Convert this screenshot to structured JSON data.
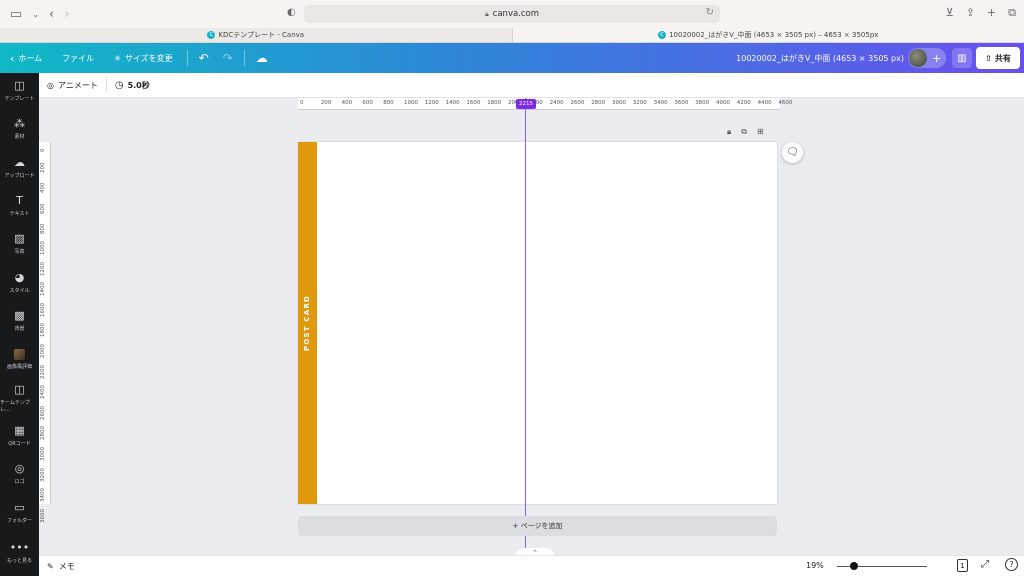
{
  "browser": {
    "url": "canva.com",
    "tabs": [
      {
        "label": "KDCテンプレート - Canva"
      },
      {
        "label": "10020002_はがきV_中面 (4653 × 3505 px) – 4653 × 3505px"
      }
    ]
  },
  "header": {
    "home": "ホーム",
    "file": "ファイル",
    "resize": "サイズを変更",
    "doc_title": "10020002_はがきV_中面 (4653 × 3505 px)",
    "share": "共有"
  },
  "sidebar": {
    "items": [
      {
        "label": "テンプレート",
        "icon": "template-icon"
      },
      {
        "label": "素材",
        "icon": "elements-icon"
      },
      {
        "label": "アップロード",
        "icon": "upload-icon"
      },
      {
        "label": "テキスト",
        "icon": "text-icon"
      },
      {
        "label": "写真",
        "icon": "photo-icon"
      },
      {
        "label": "スタイル",
        "icon": "style-icon"
      },
      {
        "label": "背景",
        "icon": "background-icon"
      },
      {
        "label": "画像風評価",
        "icon": "app-icon"
      },
      {
        "label": "チームテンプレ...",
        "icon": "team-template-icon"
      },
      {
        "label": "QRコード",
        "icon": "qr-icon"
      },
      {
        "label": "ロゴ",
        "icon": "logo-icon"
      },
      {
        "label": "フォルダー",
        "icon": "folder-icon"
      },
      {
        "label": "もっと見る",
        "icon": "more-icon"
      }
    ]
  },
  "toolbar": {
    "animate": "アニメート",
    "duration": "5.0秒"
  },
  "ruler": {
    "top_ticks": [
      "0",
      "200",
      "400",
      "600",
      "800",
      "1000",
      "1200",
      "1400",
      "1600",
      "1800",
      "2000",
      "2200",
      "2400",
      "2600",
      "2800",
      "3000",
      "3200",
      "3400",
      "3600",
      "3800",
      "4000",
      "4200",
      "4400",
      "4600"
    ],
    "left_ticks": [
      "0",
      "200",
      "400",
      "600",
      "800",
      "1000",
      "1200",
      "1400",
      "1600",
      "1800",
      "2000",
      "2200",
      "2400",
      "2600",
      "2800",
      "3000",
      "3200",
      "3400",
      "3600"
    ],
    "marker": "2215"
  },
  "canvas": {
    "strip_text": "POST CARD",
    "strip_color": "#e0980f",
    "add_page": "+ ページを追加"
  },
  "bottom": {
    "memo": "メモ",
    "zoom": "19%",
    "zoom_fraction": 0.19,
    "page_count": "1"
  }
}
